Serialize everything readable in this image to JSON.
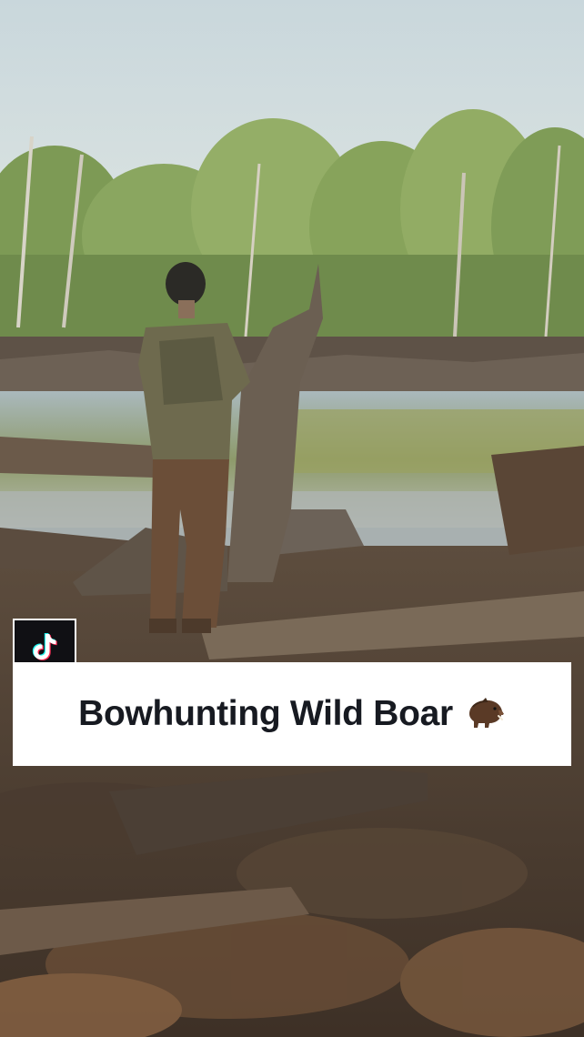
{
  "caption": {
    "title": "Bowhunting Wild Boar",
    "emoji_icon": "boar-icon"
  },
  "badge": {
    "icon": "tiktok-logo-icon"
  },
  "colors": {
    "caption_bg": "#ffffff",
    "caption_text": "#171a21",
    "badge_bg": "#101014"
  }
}
